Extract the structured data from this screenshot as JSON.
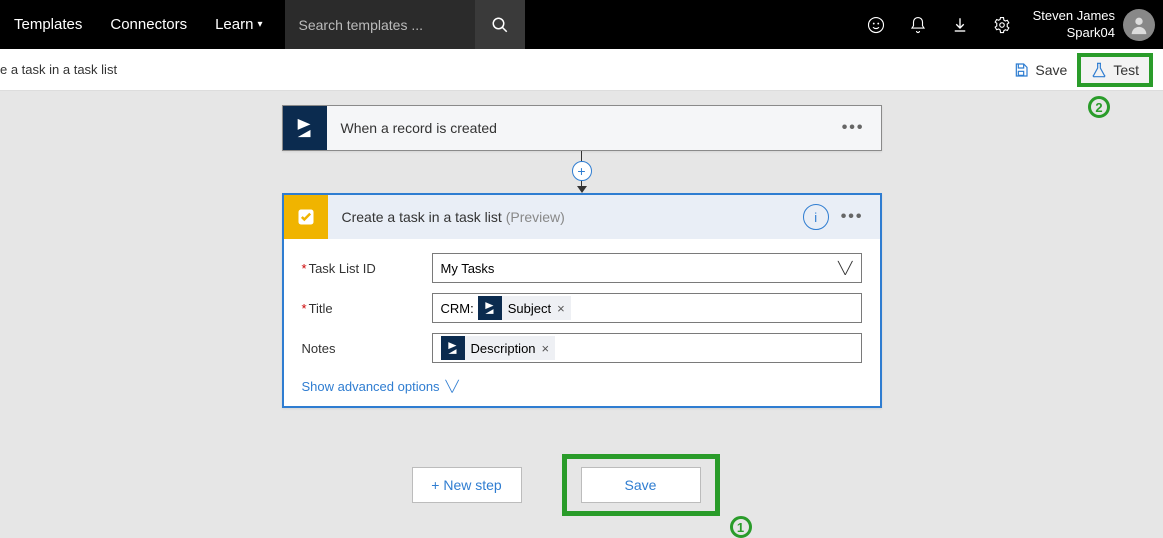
{
  "topnav": {
    "items": [
      "Templates",
      "Connectors",
      "Learn"
    ],
    "search_placeholder": "Search templates ..."
  },
  "user": {
    "name": "Steven James",
    "tenant": "Spark04"
  },
  "cmdbar": {
    "breadcrumb": "e a task in a task list",
    "save": "Save",
    "test": "Test"
  },
  "trigger": {
    "title": "When a record is created"
  },
  "action": {
    "title_main": "Create a task in a task list ",
    "title_suffix": "(Preview)",
    "fields": {
      "tasklist_label": "Task List ID",
      "tasklist_value": "My Tasks",
      "title_label": "Title",
      "title_prefix": "CRM:",
      "title_token": "Subject",
      "notes_label": "Notes",
      "notes_token": "Description"
    },
    "advanced": "Show advanced options"
  },
  "buttons": {
    "new_step": "+ New step",
    "save": "Save"
  },
  "callouts": {
    "one": "1",
    "two": "2"
  }
}
